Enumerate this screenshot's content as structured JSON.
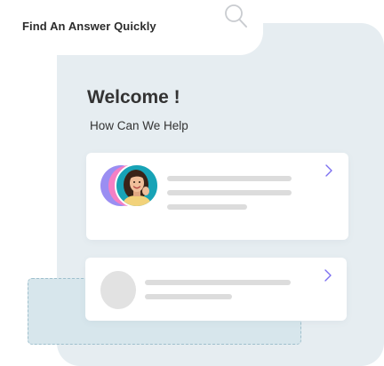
{
  "header": {
    "search_label": "Find An Answer Quickly",
    "search_icon": "magnifier"
  },
  "welcome": {
    "title": "Welcome !",
    "subtitle": "How Can We Help"
  },
  "cards": [
    {
      "avatar": "person-photo",
      "chevron_icon": "chevron-right"
    },
    {
      "avatar": "placeholder-circle",
      "chevron_icon": "chevron-right"
    }
  ],
  "colors": {
    "background_panel": "#e6edf1",
    "accent_purple": "#9a8ef2",
    "accent_pink": "#f47fc4",
    "accent_teal": "#17a3b6",
    "chevron": "#7b6ff0",
    "placeholder_line": "#dcdcdc"
  }
}
